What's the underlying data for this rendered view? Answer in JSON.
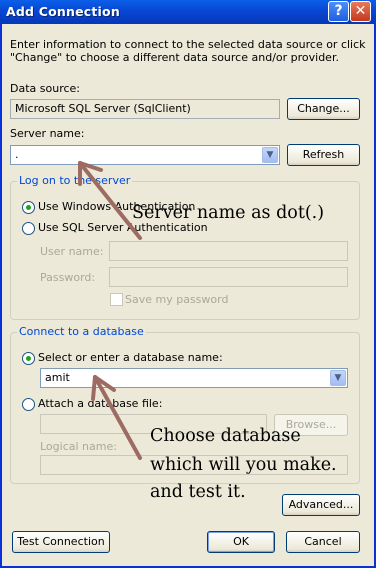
{
  "window": {
    "title": "Add Connection"
  },
  "intro_text": "Enter information to connect to the selected data source or click \"Change\" to choose a different data source and/or provider.",
  "data_source": {
    "label": "Data source:",
    "value": "Microsoft SQL Server (SqlClient)",
    "change_label": "Change..."
  },
  "server": {
    "label": "Server name:",
    "value": ".",
    "refresh_label": "Refresh"
  },
  "logon": {
    "legend": "Log on to the server",
    "windows_auth": "Use Windows Authentication",
    "sql_auth": "Use SQL Server Authentication",
    "username_label": "User name:",
    "password_label": "Password:",
    "save_password": "Save my password"
  },
  "database": {
    "legend": "Connect to a database",
    "select_option": "Select or enter a database name:",
    "db_value": "amit",
    "attach_option": "Attach a database file:",
    "browse_label": "Browse...",
    "logical_name_label": "Logical name:"
  },
  "buttons": {
    "advanced": "Advanced...",
    "test": "Test Connection",
    "ok": "OK",
    "cancel": "Cancel"
  },
  "annotations": {
    "server_note": "Server name as dot(.)",
    "db_note_1": "Choose database",
    "db_note_2": "which will you make.",
    "db_note_3": "and test it."
  },
  "colors": {
    "titlebar": "#0847d3",
    "group_legend": "#0046d5",
    "arrow": "#9d6b62",
    "dialog_bg": "#ece9d8"
  }
}
